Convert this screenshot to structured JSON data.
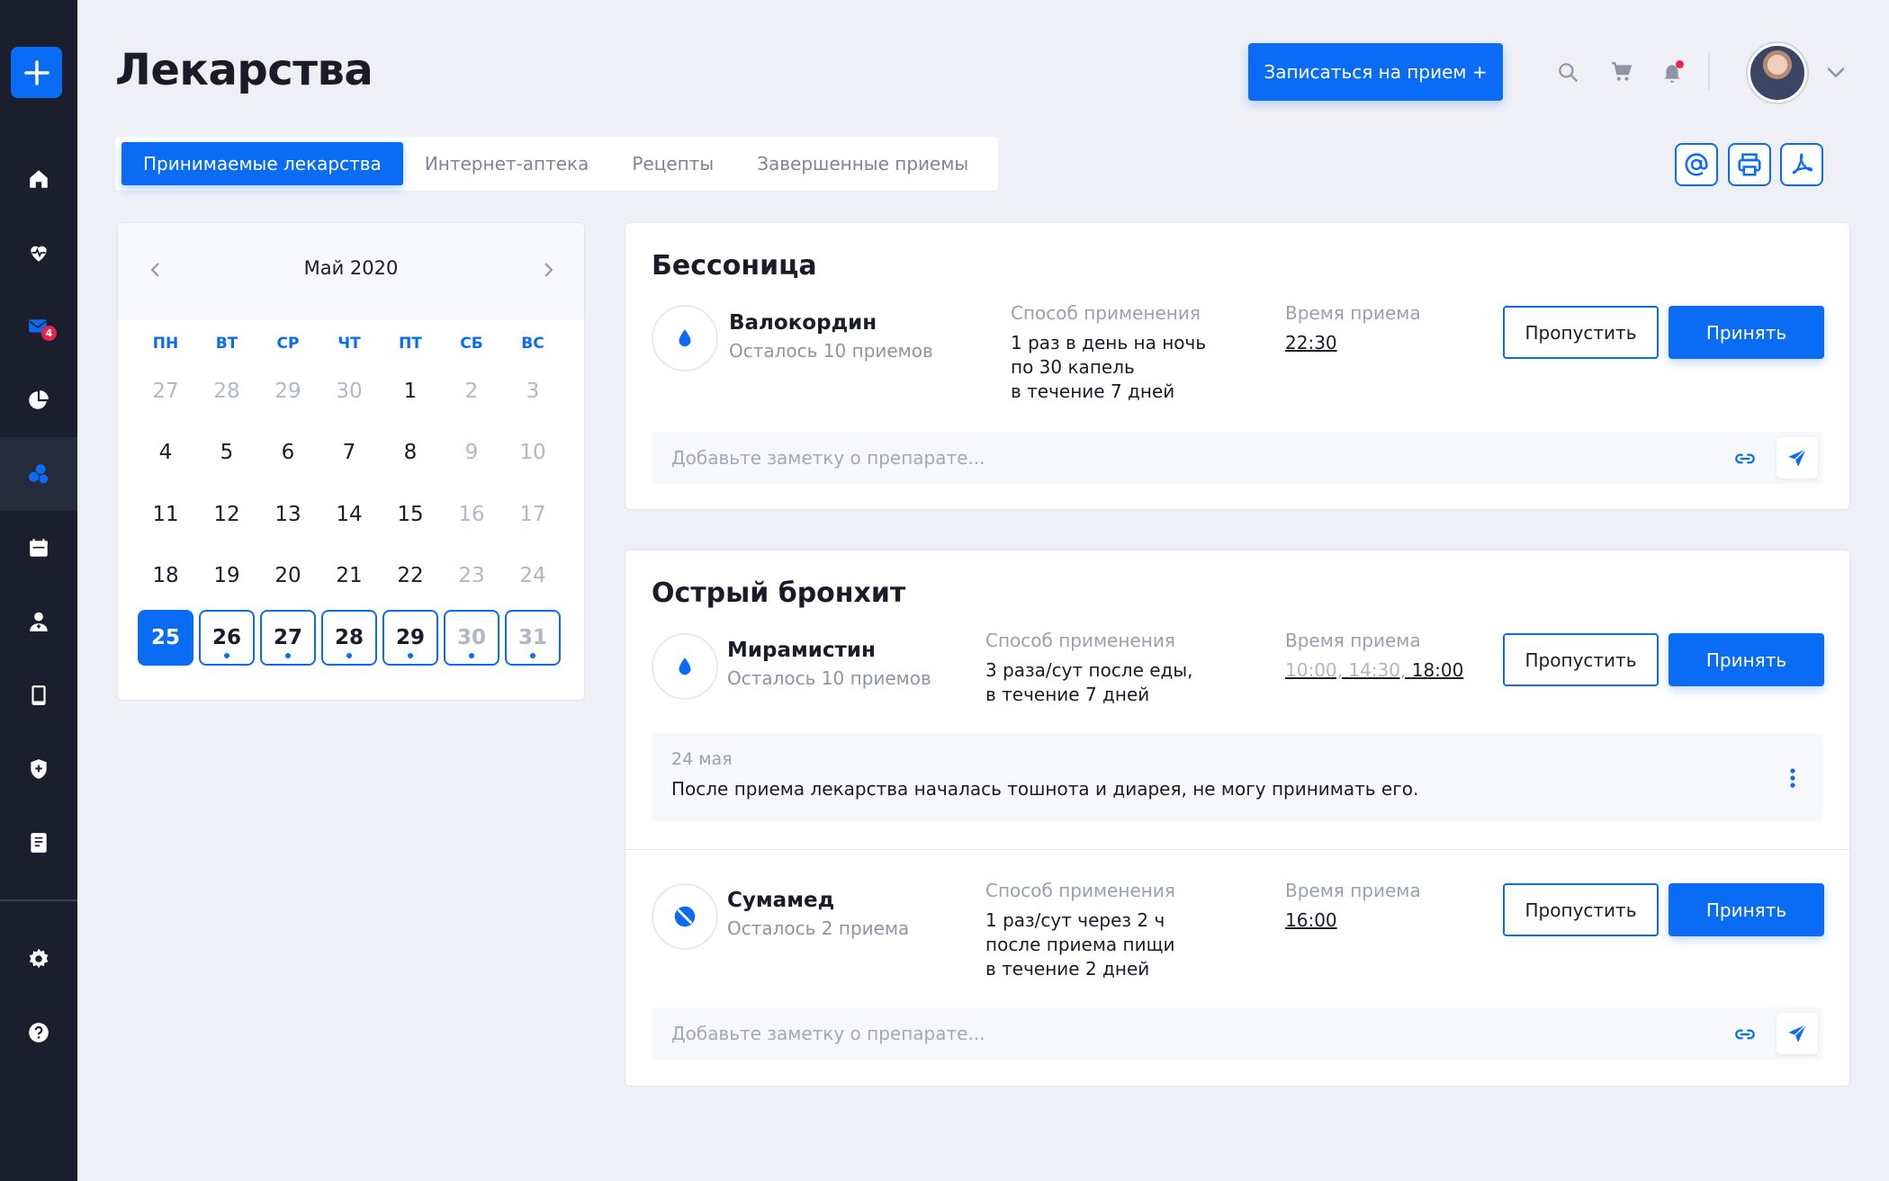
{
  "page": {
    "title": "Лекарства",
    "appointment_button": "Записаться на прием +"
  },
  "sidebar": {
    "mail_badge": "4",
    "items": [
      "home",
      "heart-pulse",
      "mail",
      "pie-chart",
      "medicines",
      "calendar",
      "doctor",
      "tablet",
      "shield",
      "book",
      "settings",
      "help"
    ]
  },
  "tabs": [
    "Принимаемые лекарства",
    "Интернет-аптека",
    "Рецепты",
    "Завершенные приемы"
  ],
  "calendar": {
    "month": "Май 2020",
    "weekdays": [
      "ПН",
      "ВТ",
      "СР",
      "ЧТ",
      "ПТ",
      "СБ",
      "ВС"
    ],
    "weeks": [
      [
        "27",
        "28",
        "29",
        "30",
        "1",
        "2",
        "3"
      ],
      [
        "4",
        "5",
        "6",
        "7",
        "8",
        "9",
        "10"
      ],
      [
        "11",
        "12",
        "13",
        "14",
        "15",
        "16",
        "17"
      ],
      [
        "18",
        "19",
        "20",
        "21",
        "22",
        "23",
        "24"
      ],
      [
        "25",
        "26",
        "27",
        "28",
        "29",
        "30",
        "31"
      ]
    ]
  },
  "labels": {
    "method": "Способ применения",
    "time": "Время приема",
    "skip": "Пропустить",
    "take": "Принять",
    "note_placeholder": "Добавьте заметку о препарате..."
  },
  "card1": {
    "title": "Бессоница",
    "med": {
      "name": "Валокордин",
      "remaining": "Осталось 10 приемов",
      "method": [
        "1 раз в день на ночь",
        "по 30 капель",
        "в течение 7 дней"
      ],
      "time": "22:30"
    }
  },
  "card2": {
    "title": "Острый бронхит",
    "med1": {
      "name": "Мирамистин",
      "remaining": "Осталось 10 приемов",
      "method": [
        "3 раза/сут после еды,",
        "в течение 7 дней"
      ],
      "time_past": "10:00, 14:30,",
      "time_next": "18:00",
      "note_date": "24 мая",
      "note_text": "После приема лекарства началась тошнота и диарея, не могу принимать его."
    },
    "med2": {
      "name": "Сумамед",
      "remaining": "Осталось 2 приема",
      "method": [
        "1 раз/сут через 2 ч",
        "после приема пищи",
        "в течение 2 дней"
      ],
      "time": "16:00"
    }
  },
  "colors": {
    "accent": "#0a6cf5",
    "sidebar": "#1b1f2d",
    "background": "#eef0f5",
    "alert": "#e8244a"
  }
}
